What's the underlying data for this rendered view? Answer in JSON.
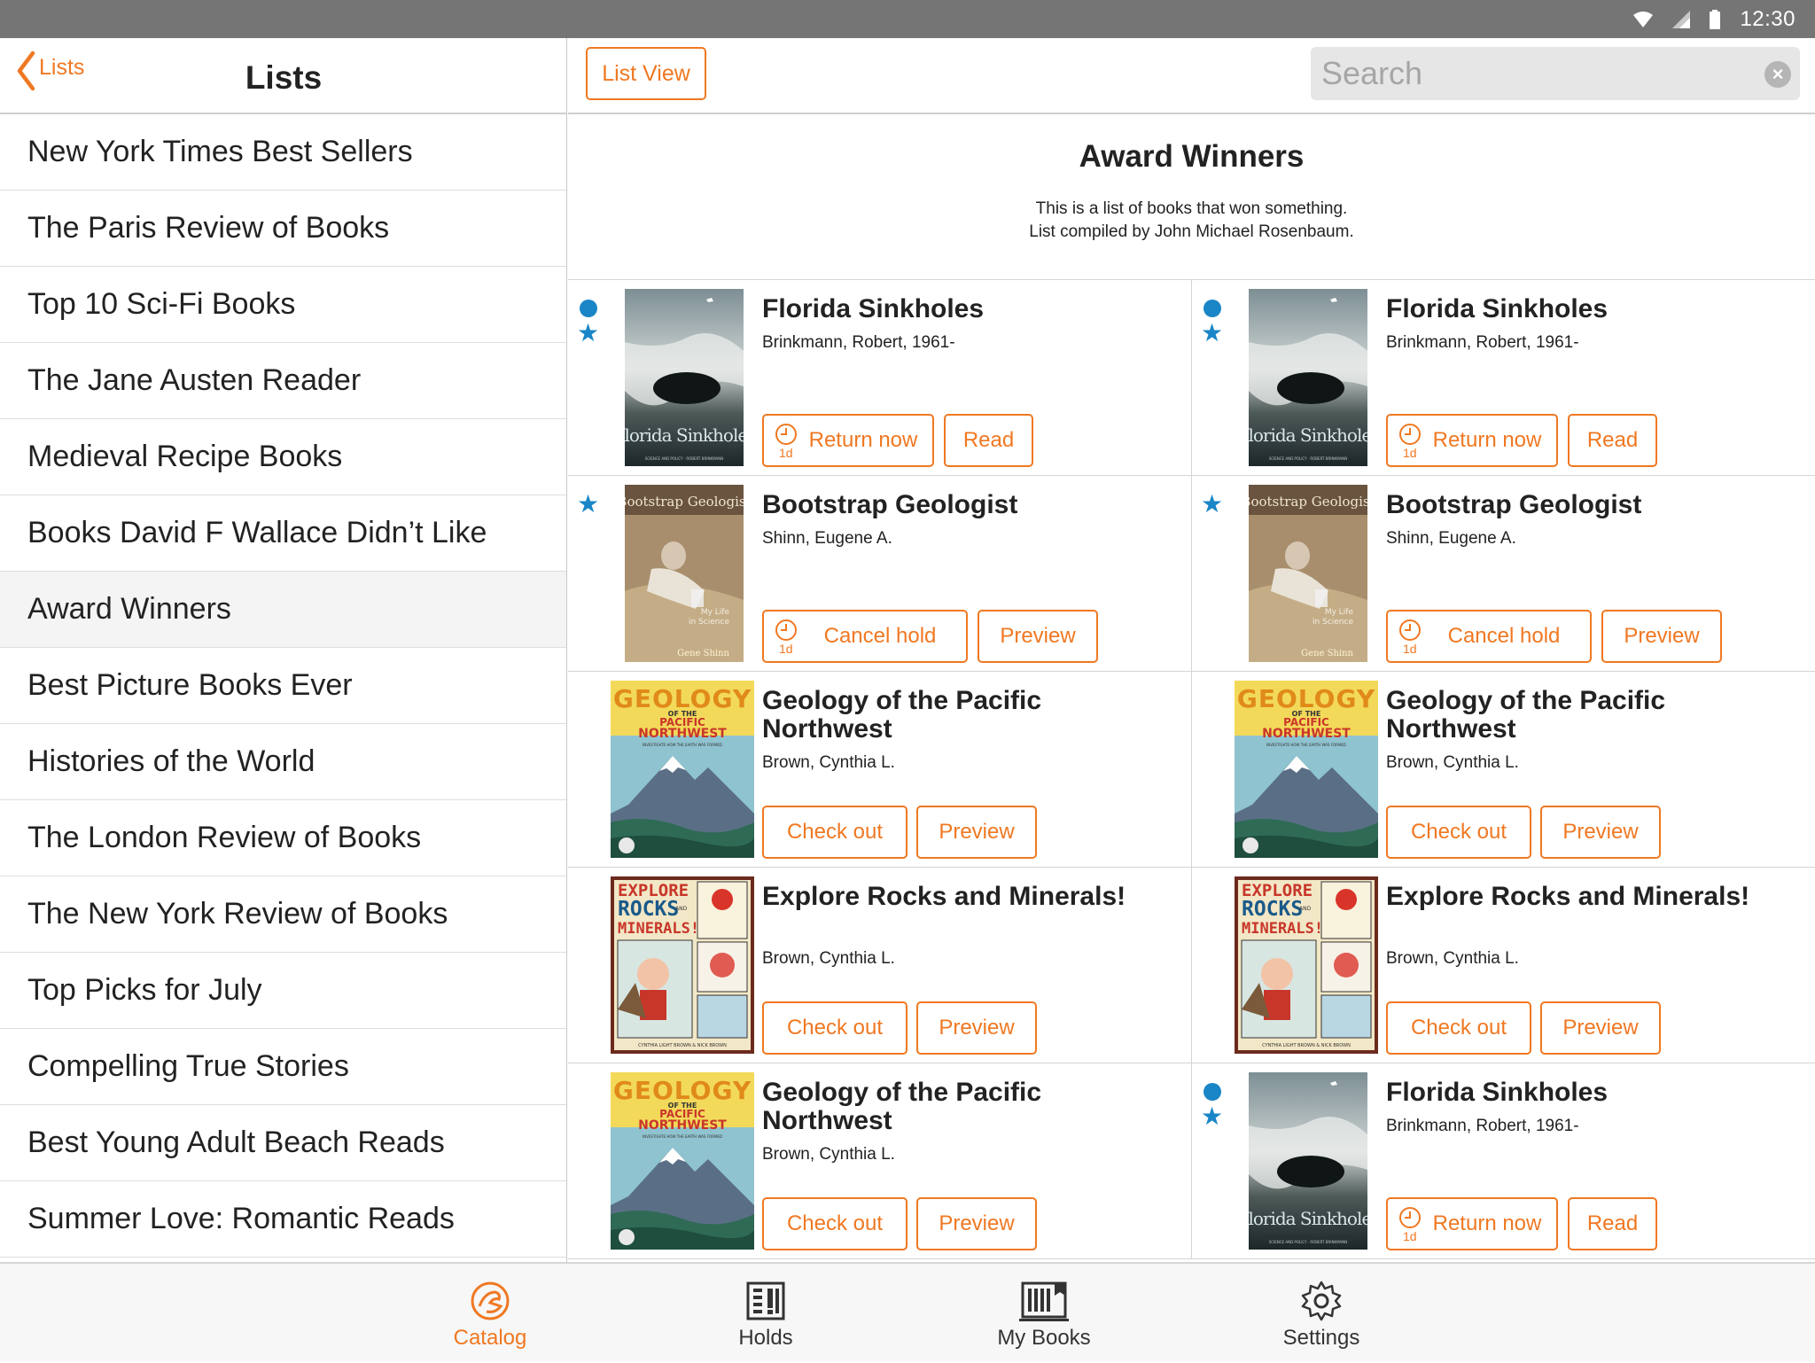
{
  "status_bar": {
    "time": "12:30",
    "icons": [
      "wifi-icon",
      "signal-icon",
      "battery-icon"
    ]
  },
  "left_header": {
    "back_label": "Lists",
    "title": "Lists"
  },
  "lists": [
    "New York Times Best Sellers",
    "The Paris Review of Books",
    "Top 10 Sci-Fi Books",
    "The Jane Austen Reader",
    "Medieval Recipe Books",
    "Books David F Wallace Didn’t Like",
    "Award Winners",
    "Best Picture Books Ever",
    "Histories of the World",
    "The London Review of Books",
    "The New York Review of Books",
    "Top Picks for July",
    "Compelling True Stories",
    "Best Young Adult Beach Reads",
    "Summer Love: Romantic Reads"
  ],
  "selected_list": "Award Winners",
  "right_header": {
    "list_view_label": "List View",
    "search_placeholder": "Search",
    "search_value": ""
  },
  "list_detail": {
    "title": "Award Winners",
    "description": "This is a list of books that won something.",
    "compiled_by": "List compiled by John Michael Rosenbaum."
  },
  "covers": {
    "florida": {
      "title": "Florida Sinkholes",
      "sub": "SCIENCE AND POLICY · ROBERT BRINKMANN"
    },
    "bootstrap": {
      "title": "Bootstrap Geologist",
      "sub1": "My Life",
      "sub2": "in Science",
      "author": "Gene Shinn"
    },
    "geology": {
      "w1": "GEOLOGY",
      "w2": "OF THE",
      "w3": "PACIFIC",
      "w4": "NORTHWEST",
      "tag": "INVESTIGATE HOW THE EARTH WAS FORMED"
    },
    "explore": {
      "w1": "EXPLORE",
      "w2": "ROCKS",
      "w3": "AND",
      "w4": "MINERALS!",
      "tag": "CYNTHIA LIGHT BROWN & NICK BROWN"
    }
  },
  "books": [
    {
      "cover": "florida",
      "title": "Florida Sinkholes",
      "author": "Brinkmann, Robert, 1961-",
      "dot": true,
      "star": true,
      "primary": "Return now",
      "secondary": "Read",
      "badge": "1d",
      "kind": "return"
    },
    {
      "cover": "florida",
      "title": "Florida Sinkholes",
      "author": "Brinkmann, Robert, 1961-",
      "dot": true,
      "star": true,
      "primary": "Return now",
      "secondary": "Read",
      "badge": "1d",
      "kind": "return"
    },
    {
      "cover": "bootstrap",
      "title": "Bootstrap Geologist",
      "author": "Shinn, Eugene A.",
      "dot": false,
      "star": true,
      "primary": "Cancel hold",
      "secondary": "Preview",
      "badge": "1d",
      "kind": "cancel"
    },
    {
      "cover": "bootstrap",
      "title": "Bootstrap Geologist",
      "author": "Shinn, Eugene A.",
      "dot": false,
      "star": true,
      "primary": "Cancel hold",
      "secondary": "Preview",
      "badge": "1d",
      "kind": "cancel"
    },
    {
      "cover": "geology",
      "title": "Geology of the Pacific Northwest",
      "author": "Brown, Cynthia L.",
      "dot": false,
      "star": false,
      "primary": "Check out",
      "secondary": "Preview",
      "badge": "",
      "kind": "check"
    },
    {
      "cover": "geology",
      "title": "Geology of the Pacific Northwest",
      "author": "Brown, Cynthia L.",
      "dot": false,
      "star": false,
      "primary": "Check out",
      "secondary": "Preview",
      "badge": "",
      "kind": "check"
    },
    {
      "cover": "explore",
      "title": "Explore Rocks and Minerals!",
      "author": "Brown, Cynthia L.",
      "dot": false,
      "star": false,
      "primary": "Check out",
      "secondary": "Preview",
      "badge": "",
      "kind": "check"
    },
    {
      "cover": "explore",
      "title": "Explore Rocks and Minerals!",
      "author": "Brown, Cynthia L.",
      "dot": false,
      "star": false,
      "primary": "Check out",
      "secondary": "Preview",
      "badge": "",
      "kind": "check"
    },
    {
      "cover": "geology",
      "title": "Geology of the Pacific Northwest",
      "author": "Brown, Cynthia L.",
      "dot": false,
      "star": false,
      "primary": "Check out",
      "secondary": "Preview",
      "badge": "",
      "kind": "check"
    },
    {
      "cover": "florida",
      "title": "Florida Sinkholes",
      "author": "Brinkmann, Robert, 1961-",
      "dot": true,
      "star": true,
      "primary": "Return now",
      "secondary": "Read",
      "badge": "1d",
      "kind": "return"
    }
  ],
  "tabs": [
    {
      "label": "Catalog",
      "icon": "catalog-icon",
      "active": true
    },
    {
      "label": "Holds",
      "icon": "holds-icon",
      "active": false
    },
    {
      "label": "My Books",
      "icon": "my-books-icon",
      "active": false
    },
    {
      "label": "Settings",
      "icon": "settings-icon",
      "active": false
    }
  ],
  "colors": {
    "accent": "#f07822",
    "blue": "#1a86c7",
    "status_bar": "#757575"
  }
}
